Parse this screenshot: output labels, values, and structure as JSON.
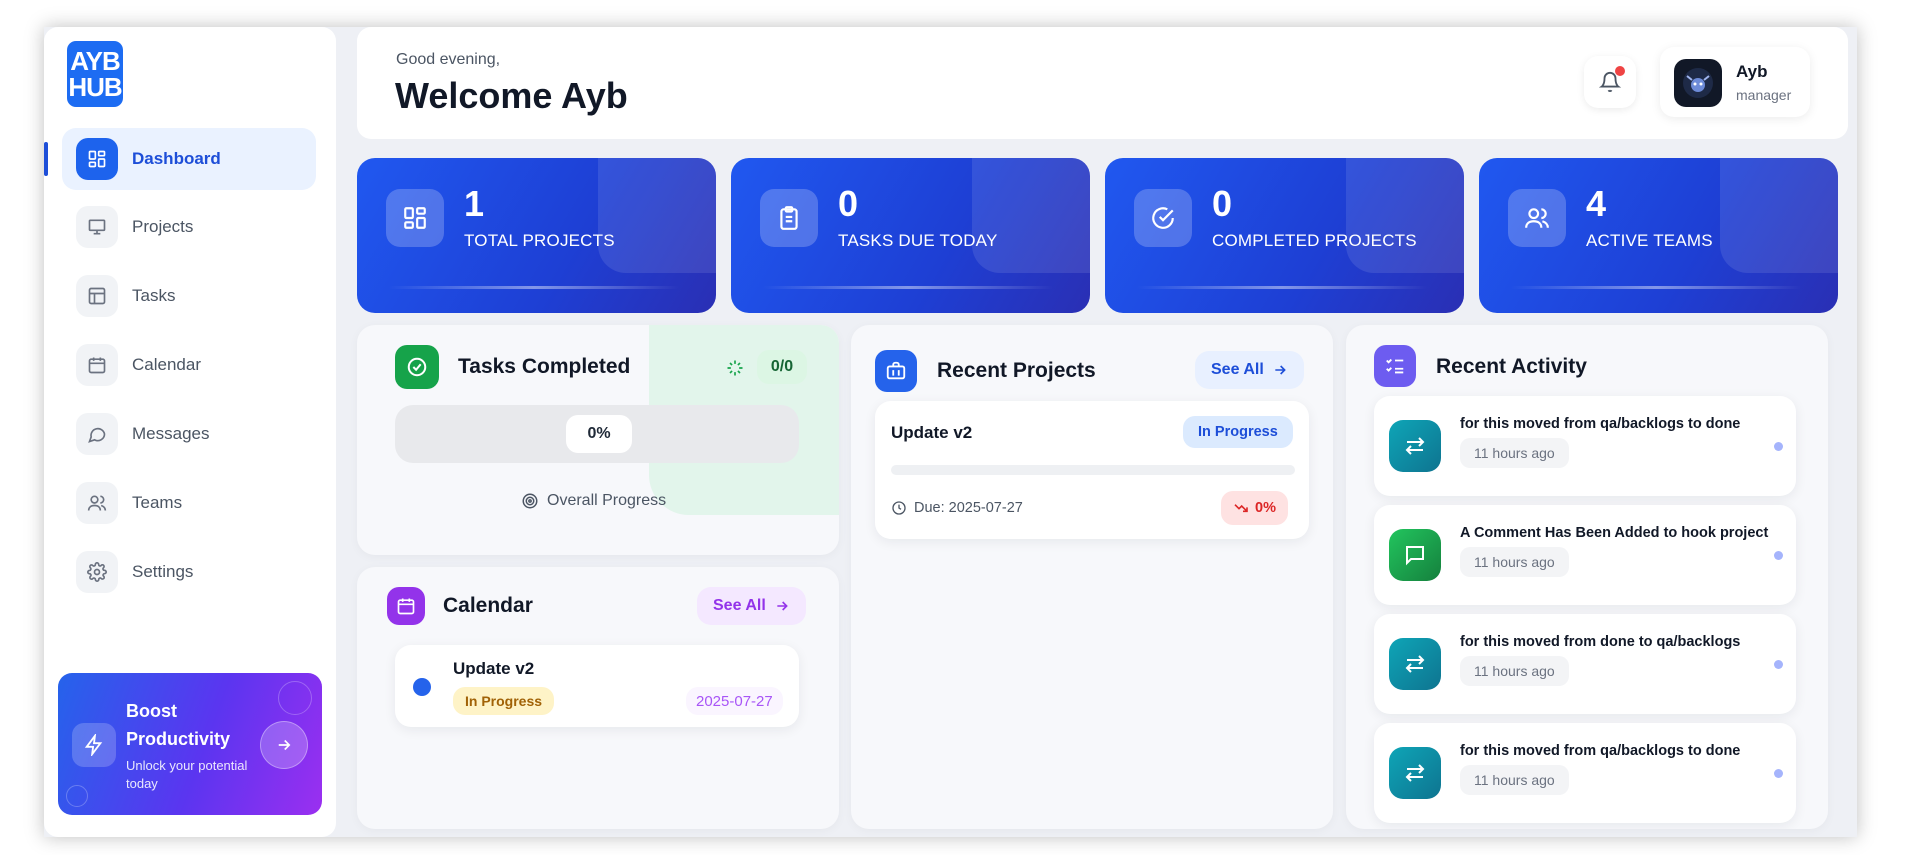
{
  "logo": {
    "line1": "AYB",
    "line2": "HUB"
  },
  "nav": [
    {
      "label": "Dashboard",
      "icon": "dashboard-icon",
      "active": true
    },
    {
      "label": "Projects",
      "icon": "presentation-icon"
    },
    {
      "label": "Tasks",
      "icon": "layout-icon"
    },
    {
      "label": "Calendar",
      "icon": "calendar-icon"
    },
    {
      "label": "Messages",
      "icon": "chat-icon"
    },
    {
      "label": "Teams",
      "icon": "users-icon"
    },
    {
      "label": "Settings",
      "icon": "gear-icon"
    }
  ],
  "boost": {
    "title": "Boost Productivity",
    "subtitle": "Unlock your potential today"
  },
  "header": {
    "greeting": "Good evening,",
    "welcome": "Welcome Ayb",
    "user_name": "Ayb",
    "user_role": "manager"
  },
  "stats": [
    {
      "value": "1",
      "label": "TOTAL PROJECTS",
      "icon": "grid-icon"
    },
    {
      "value": "0",
      "label": "TASKS DUE TODAY",
      "icon": "clipboard-icon"
    },
    {
      "value": "0",
      "label": "COMPLETED PROJECTS",
      "icon": "check-circle-icon"
    },
    {
      "value": "4",
      "label": "ACTIVE TEAMS",
      "icon": "users-icon"
    }
  ],
  "tasks_completed": {
    "title": "Tasks Completed",
    "badge": "0/0",
    "percent": "0%",
    "caption": "Overall Progress"
  },
  "calendar": {
    "title": "Calendar",
    "see_all": "See All",
    "event": {
      "name": "Update v2",
      "status": "In Progress",
      "date": "2025-07-27"
    }
  },
  "recent_projects": {
    "title": "Recent Projects",
    "see_all": "See All",
    "project": {
      "name": "Update v2",
      "status": "In Progress",
      "due": "Due: 2025-07-27",
      "progress": "0%"
    }
  },
  "recent_activity": {
    "title": "Recent Activity",
    "items": [
      {
        "text": "for this moved from qa/backlogs to done",
        "time": "11 hours ago",
        "type": "move"
      },
      {
        "text": "A Comment Has Been Added to hook project",
        "time": "11 hours ago",
        "type": "comment"
      },
      {
        "text": "for this moved from done to qa/backlogs",
        "time": "11 hours ago",
        "type": "move"
      },
      {
        "text": "for this moved from qa/backlogs to done",
        "time": "11 hours ago",
        "type": "move"
      }
    ]
  },
  "colors": {
    "primary": "#1d63ed",
    "success": "#16a34a",
    "purple": "#9333ea",
    "teal": "#0891b2",
    "danger": "#ef4444"
  }
}
